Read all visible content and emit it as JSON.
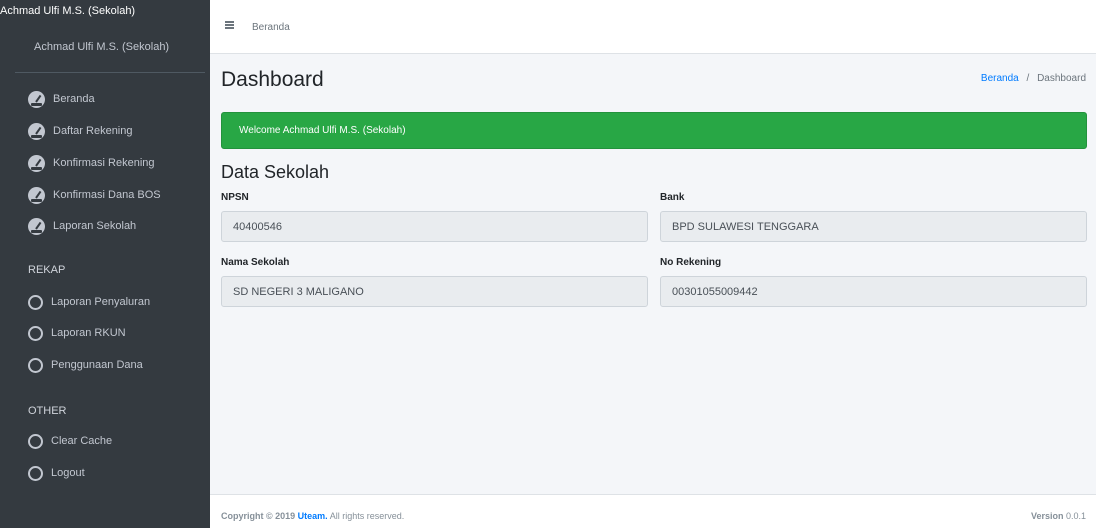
{
  "sidebar": {
    "brand_text": "Achmad Ulfi M.S. (Sekolah)",
    "user_name": "Achmad Ulfi M.S. (Sekolah)",
    "items": [
      {
        "label": "Beranda",
        "icon": "tachometer-icon"
      },
      {
        "label": "Daftar Rekening",
        "icon": "tachometer-icon"
      },
      {
        "label": "Konfirmasi Rekening",
        "icon": "tachometer-icon"
      },
      {
        "label": "Konfirmasi Dana BOS",
        "icon": "tachometer-icon"
      },
      {
        "label": "Laporan Sekolah",
        "icon": "tachometer-icon"
      }
    ],
    "rekap_header": "REKAP",
    "rekap_items": [
      {
        "label": "Laporan Penyaluran",
        "icon": "circle-icon"
      },
      {
        "label": "Laporan RKUN",
        "icon": "circle-icon"
      },
      {
        "label": "Penggunaan Dana",
        "icon": "circle-icon"
      }
    ],
    "other_header": "OTHER",
    "other_items": [
      {
        "label": "Clear Cache",
        "icon": "circle-icon"
      },
      {
        "label": "Logout",
        "icon": "circle-icon"
      }
    ]
  },
  "topbar": {
    "menu_icon": "hamburger-icon",
    "home_link": "Beranda"
  },
  "header": {
    "title": "Dashboard",
    "breadcrumb_home": "Beranda",
    "breadcrumb_separator": "/",
    "breadcrumb_current": "Dashboard"
  },
  "alert": {
    "text": "Welcome Achmad Ulfi M.S. (Sekolah)"
  },
  "data_sekolah": {
    "title": "Data Sekolah",
    "npsn_label": "NPSN",
    "npsn_value": "40400546",
    "bank_label": "Bank",
    "bank_value": "BPD SULAWESI TENGGARA",
    "nama_label": "Nama Sekolah",
    "nama_value": "SD NEGERI 3 MALIGANO",
    "rekening_label": "No Rekening",
    "rekening_value": "00301055009442"
  },
  "footer": {
    "copyright_prefix": "Copyright © 2019",
    "brand": "Uteam.",
    "rights": "All rights reserved.",
    "version_label": "Version",
    "version_value": "0.0.1"
  },
  "colors": {
    "sidebar_bg": "#343a40",
    "alert_bg": "#28a745",
    "link": "#007bff",
    "content_bg": "#f4f6f9"
  }
}
